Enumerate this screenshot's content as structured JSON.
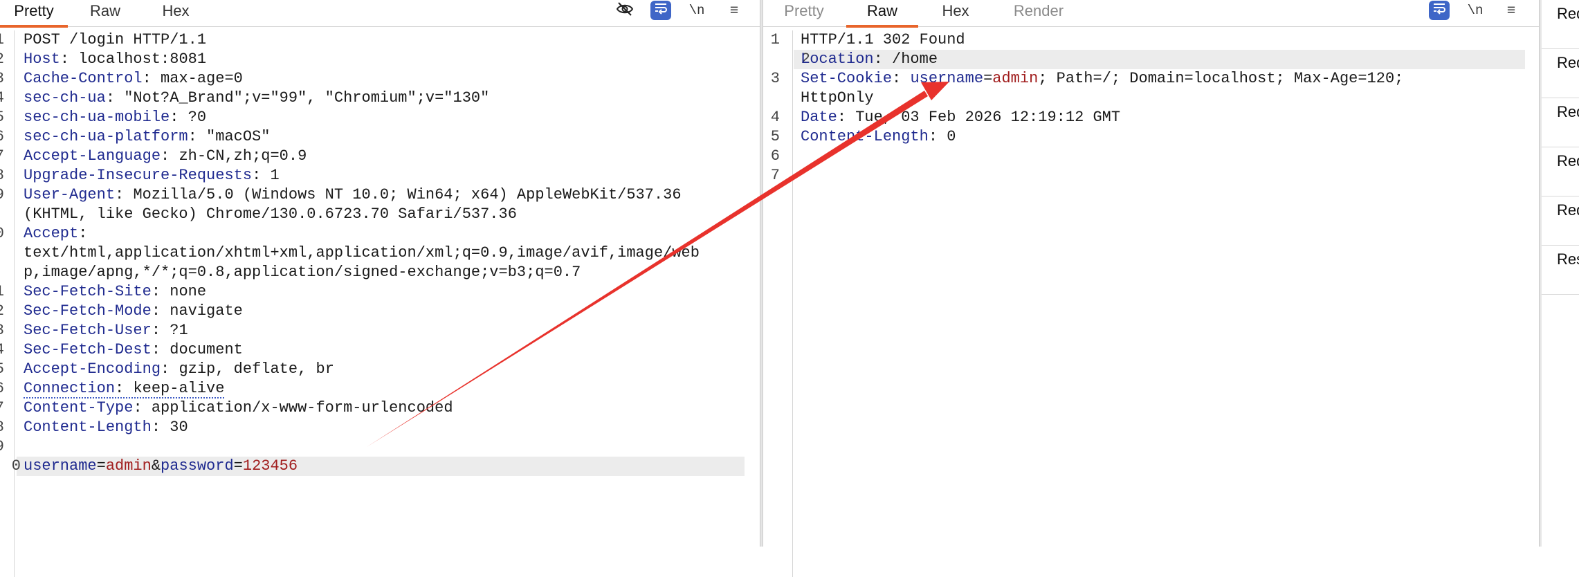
{
  "request": {
    "tabs": [
      {
        "label": "Pretty",
        "active": true
      },
      {
        "label": "Raw",
        "active": false
      },
      {
        "label": "Hex",
        "active": false
      }
    ],
    "tools": {
      "newline_label": "\\n",
      "menu_label": "≡"
    },
    "lines": [
      {
        "n": "1",
        "text": "POST /login HTTP/1.1"
      },
      {
        "n": "2",
        "key": "Host",
        "value": "localhost:8081"
      },
      {
        "n": "3",
        "key": "Cache-Control",
        "value": "max-age=0"
      },
      {
        "n": "4",
        "key": "sec-ch-ua",
        "value": "\"Not?A_Brand\";v=\"99\", \"Chromium\";v=\"130\""
      },
      {
        "n": "5",
        "key": "sec-ch-ua-mobile",
        "value": "?0"
      },
      {
        "n": "6",
        "key": "sec-ch-ua-platform",
        "value": "\"macOS\""
      },
      {
        "n": "7",
        "key": "Accept-Language",
        "value": "zh-CN,zh;q=0.9"
      },
      {
        "n": "8",
        "key": "Upgrade-Insecure-Requests",
        "value": "1"
      },
      {
        "n": "9",
        "key": "User-Agent",
        "value": "Mozilla/5.0 (Windows NT 10.0; Win64; x64) AppleWebKit/537.36"
      },
      {
        "n": "",
        "text": "(KHTML, like Gecko) Chrome/130.0.6723.70 Safari/537.36"
      },
      {
        "n": "0",
        "key": "Accept",
        "value": ""
      },
      {
        "n": "",
        "text": "text/html,application/xhtml+xml,application/xml;q=0.9,image/avif,image/web"
      },
      {
        "n": "",
        "text": "p,image/apng,*/*;q=0.8,application/signed-exchange;v=b3;q=0.7"
      },
      {
        "n": "1",
        "key": "Sec-Fetch-Site",
        "value": "none"
      },
      {
        "n": "2",
        "key": "Sec-Fetch-Mode",
        "value": "navigate"
      },
      {
        "n": "3",
        "key": "Sec-Fetch-User",
        "value": "?1"
      },
      {
        "n": "4",
        "key": "Sec-Fetch-Dest",
        "value": "document"
      },
      {
        "n": "5",
        "key": "Accept-Encoding",
        "value": "gzip, deflate, br"
      },
      {
        "n": "6",
        "key": "Connection",
        "value": "keep-alive",
        "dotted": true
      },
      {
        "n": "7",
        "key": "Content-Type",
        "value": "application/x-www-form-urlencoded"
      },
      {
        "n": "8",
        "key": "Content-Length",
        "value": "30"
      },
      {
        "n": "9",
        "text": ""
      },
      {
        "n": "0",
        "body": true,
        "highlight": true
      }
    ],
    "body_params": [
      {
        "key": "username",
        "value": "admin"
      },
      {
        "key": "password",
        "value": "123456"
      }
    ]
  },
  "response": {
    "tabs": [
      {
        "label": "Pretty",
        "active": false,
        "dim": true
      },
      {
        "label": "Raw",
        "active": true
      },
      {
        "label": "Hex",
        "active": false
      },
      {
        "label": "Render",
        "active": false,
        "dim": true
      }
    ],
    "tools": {
      "newline_label": "\\n",
      "menu_label": "≡"
    },
    "lines": [
      {
        "n": "1",
        "text": "HTTP/1.1 302 Found"
      },
      {
        "n": "2",
        "key": "Location",
        "value": "/home",
        "highlight": true
      },
      {
        "n": "3",
        "key": "Set-Cookie",
        "cookie": true
      },
      {
        "n": "",
        "text": "HttpOnly"
      },
      {
        "n": "4",
        "key": "Date",
        "value": "Tue, 03 Feb 2026 12:19:12 GMT"
      },
      {
        "n": "5",
        "key": "Content-Length",
        "value": "0"
      },
      {
        "n": "6",
        "text": ""
      },
      {
        "n": "7",
        "text": ""
      }
    ],
    "cookie": {
      "name": "username",
      "value": "admin",
      "rest": "; Path=/; Domain=localhost; Max-Age=120;"
    }
  },
  "sidebar": {
    "items": [
      "Req",
      "Req",
      "Req",
      "Req",
      "Req",
      "Res"
    ]
  },
  "colors": {
    "accent": "#e8652b",
    "header_name": "#1f2a8f",
    "param_value": "#a11e1e",
    "wrap_button": "#3f66c7",
    "arrow": "#e8322c"
  }
}
